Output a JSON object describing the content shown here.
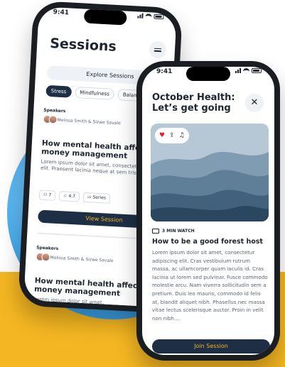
{
  "colors": {
    "accent": "#f4b622",
    "navy": "#1e2e44",
    "blue": "#3fa7ea"
  },
  "phone1": {
    "status_time": "9:41",
    "title": "Sessions",
    "explore_label": "Explore Sessions",
    "chips": [
      "Stress",
      "Mindfulness",
      "Balance"
    ],
    "cards": [
      {
        "kicker": "Speakers",
        "speakers": "Melissa Smith & Sizwe Savale",
        "title": "How mental health affects your money management",
        "body": "Lorem ipsum dolor sit amet, consectetur adipiscing elit. Praesent lacinia neque at sem tristique tempor",
        "stats": [
          "7",
          "4.7",
          "Series"
        ],
        "button": "View Session"
      },
      {
        "kicker": "Speakers",
        "speakers": "Melissa Smith & Sizwe Savale",
        "title": "How mental health affects your money management",
        "body": "Lorem ipsum dolor sit amet,"
      }
    ]
  },
  "phone2": {
    "status_time": "9:41",
    "title": "October Health: Let’s get going",
    "hero_icons": [
      "heart-icon",
      "share-icon",
      "bell-icon"
    ],
    "watch_label": "3 MIN WATCH",
    "episode_title": "How to be a good forest host",
    "episode_body": "Lorem ipsum dolor sit amet, consectetur adipiscing elit. Cras vestibulum rutrum massa, ac ullamcorper quam iaculis id. Cras lacinia ut lorem sed pulvinar. Fusce commodo molestie arcu. Nam viverra sollicitudin sem a pretium. Duis leo mauris, commodo id felis at, blandit aliquet nibh. Phasellus nec massa vitae lectus scelerisque auctor. Proin in velit non nibh...",
    "button": "Join Session"
  }
}
